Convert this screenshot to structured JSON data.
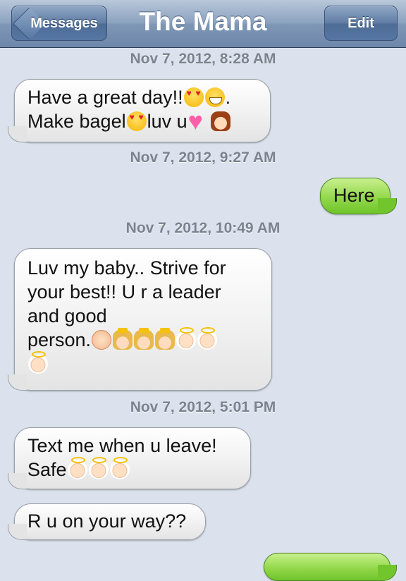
{
  "navbar": {
    "back_label": "Messages",
    "title": "The Mama",
    "edit_label": "Edit"
  },
  "colors": {
    "sent_bubble": "#7fcd3a",
    "received_bubble": "#f0f0f0",
    "background": "#dbe2ed",
    "navbar": "#7f97b6"
  },
  "timestamps": [
    "Nov 7, 2012, 8:28 AM",
    "Nov 7, 2012, 9:27 AM",
    "Nov 7, 2012, 10:49 AM",
    "Nov 7, 2012, 5:01 PM"
  ],
  "messages": [
    {
      "direction": "received",
      "lines": [
        "Have a great day!!",
        ".",
        "Make bagel",
        "luv u"
      ],
      "emoji": [
        "smiling-face-with-heart-eyes",
        "grinning-face",
        "smiling-face-with-heart-eyes",
        "growing-heart",
        "girl"
      ]
    },
    {
      "direction": "sent",
      "lines": [
        "Here"
      ]
    },
    {
      "direction": "received",
      "lines": [
        "Luv my baby.. Strive for",
        "your best!! U r a leader",
        "and good",
        "person."
      ],
      "emoji": [
        "baby",
        "princess",
        "princess",
        "princess",
        "baby-angel",
        "baby-angel",
        "baby-angel"
      ]
    },
    {
      "direction": "received",
      "lines": [
        "Text me when u leave!",
        "Safe"
      ],
      "emoji": [
        "baby-angel",
        "baby-angel",
        "baby-angel"
      ]
    },
    {
      "direction": "received",
      "lines": [
        "R u on your way??"
      ]
    }
  ]
}
